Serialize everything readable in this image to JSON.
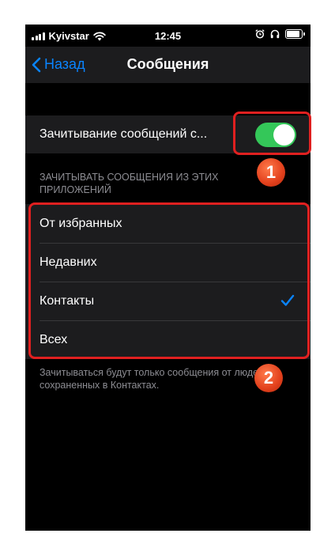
{
  "status_bar": {
    "carrier": "Kyivstar",
    "time": "12:45",
    "icons": [
      "signal-icon",
      "wifi-icon",
      "alarm-icon",
      "headphones-icon",
      "battery-icon"
    ],
    "battery_level": 0.8
  },
  "nav": {
    "back_label": "Назад",
    "title": "Сообщения"
  },
  "toggle": {
    "label": "Зачитывание сообщений с...",
    "on": true,
    "on_color": "#34c759"
  },
  "section_header": "Зачитывать сообщения из этих приложений",
  "options": [
    {
      "label": "От избранных",
      "selected": false
    },
    {
      "label": "Недавних",
      "selected": false
    },
    {
      "label": "Контакты",
      "selected": true
    },
    {
      "label": "Всех",
      "selected": false
    }
  ],
  "footer_note": "Зачитываться будут только сообщения от людей, сохраненных в Контактах.",
  "annotations": {
    "badge_1": "1",
    "badge_2": "2",
    "highlight_color": "#e02020"
  },
  "colors": {
    "accent": "#0a84ff",
    "background": "#000000",
    "cell": "#1c1c1e"
  }
}
